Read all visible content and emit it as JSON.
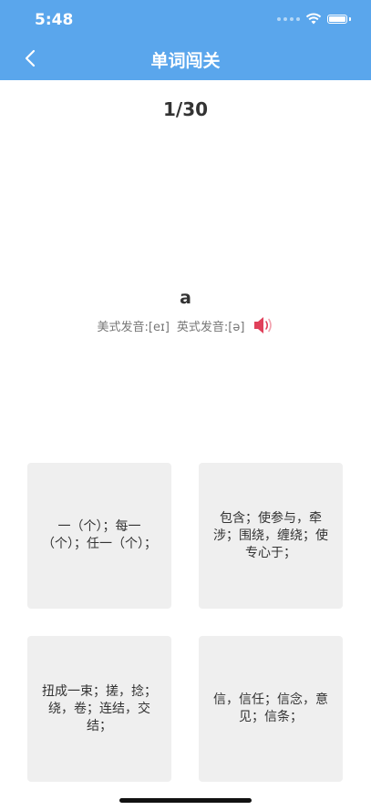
{
  "status_bar": {
    "time": "5:48"
  },
  "nav": {
    "title": "单词闯关"
  },
  "quiz": {
    "counter": "1/30",
    "word": "a",
    "phonetic_us": "美式发音:[eɪ]",
    "phonetic_uk": "英式发音:[ə]",
    "options": [
      "一（个）；每一（个）；任一（个）；",
      "包含；使参与，牵涉；围绕，缠绕；使专心于；",
      "扭成一束；搓，捻；绕，卷；连结，交结；",
      "信，信任；信念，意见；信条；"
    ]
  },
  "colors": {
    "header": "#5aa6ec",
    "speaker": "#e0405a",
    "option_bg": "#efefef"
  },
  "icons": [
    "back-chevron-icon",
    "wifi-icon",
    "battery-icon",
    "speaker-icon"
  ]
}
